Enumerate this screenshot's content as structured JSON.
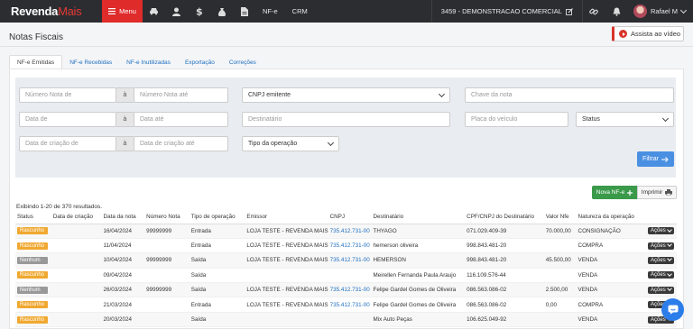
{
  "brand": {
    "name": "Revenda",
    "suffix": "Mais"
  },
  "topnav": {
    "menu_label": "Menu",
    "nfe_label": "NF-e",
    "crm_label": "CRM",
    "company": "3459 - DEMONSTRACAO COMERCIAL",
    "user": "Rafael M"
  },
  "header": {
    "title": "Notas Fiscais",
    "video_button": "Assista ao vídeo"
  },
  "tabs": [
    {
      "label": "NF-e Emitidas"
    },
    {
      "label": "NF-e Recebidas"
    },
    {
      "label": "NF-e Inutilizadas"
    },
    {
      "label": "Exportação"
    },
    {
      "label": "Correções"
    }
  ],
  "filters": {
    "numero_de": "Número Nota de",
    "numero_ate": "Número Nota até",
    "a": "à",
    "cnpj": "CNPJ emitente",
    "chave": "Chave da nota",
    "data_de": "Data de",
    "data_ate": "Data até",
    "destinatario": "Destinatário",
    "placa": "Placa do veículo",
    "status": "Status",
    "criacao_de": "Data de criação de",
    "criacao_ate": "Data de criação até",
    "tipo": "Tipo da operação",
    "filtrar": "Filtrar"
  },
  "actions": {
    "nova": "Nova NF-e",
    "imprimir": "Imprimir"
  },
  "results_text": "Exibindo 1-20 de 370 resultados.",
  "table": {
    "headers": [
      "Status",
      "Data de criação",
      "Data da nota",
      "Número Nota",
      "Tipo de operação",
      "Emissor",
      "CNPJ",
      "Destinatário",
      "CPF/CNPJ do Destinatário",
      "Valor Nfe",
      "Natureza da operação",
      ""
    ],
    "actions_label": "Ações",
    "rows": [
      {
        "status": "Rascunho",
        "criacao": "",
        "data": "16/04/2024",
        "numero": "99999999",
        "tipo": "Entrada",
        "emissor": "LOJA TESTE - REVENDA MAIS",
        "cnpj": "735.412.731-00",
        "dest": "THYAGO",
        "doc": "071.029.409-39",
        "valor": "70.000,00",
        "natureza": "CONSIGNAÇÃO"
      },
      {
        "status": "Rascunho",
        "criacao": "",
        "data": "11/04/2024",
        "numero": "",
        "tipo": "Entrada",
        "emissor": "LOJA TESTE - REVENDA MAIS",
        "cnpj": "735.412.731-00",
        "dest": "hemerson oliveira",
        "doc": "998.843.481-20",
        "valor": "",
        "natureza": "COMPRA"
      },
      {
        "status": "Nenhum",
        "criacao": "",
        "data": "10/04/2024",
        "numero": "99999999",
        "tipo": "Saída",
        "emissor": "LOJA TESTE - REVENDA MAIS",
        "cnpj": "735.412.731-00",
        "dest": "HEMERSON",
        "doc": "998.843.481-20",
        "valor": "45.500,00",
        "natureza": "VENDA"
      },
      {
        "status": "Rascunho",
        "criacao": "",
        "data": "09/04/2024",
        "numero": "",
        "tipo": "Saída",
        "emissor": "",
        "cnpj": "",
        "dest": "Meirellen Fernanda Paula Araujo",
        "doc": "116.109.576-44",
        "valor": "",
        "natureza": "VENDA"
      },
      {
        "status": "Nenhum",
        "criacao": "",
        "data": "26/03/2024",
        "numero": "99999999",
        "tipo": "Saída",
        "emissor": "LOJA TESTE - REVENDA MAIS",
        "cnpj": "735.412.731-00",
        "dest": "Felipe Gardel Gomes de Oliveira",
        "doc": "086.563.086-02",
        "valor": "2.500,00",
        "natureza": "VENDA"
      },
      {
        "status": "Rascunho",
        "criacao": "",
        "data": "21/03/2024",
        "numero": "",
        "tipo": "Entrada",
        "emissor": "LOJA TESTE - REVENDA MAIS",
        "cnpj": "735.412.731-00",
        "dest": "Felipe Gardel Gomes de Oliveira",
        "doc": "086.563.086-02",
        "valor": "0,00",
        "natureza": "COMPRA"
      },
      {
        "status": "Rascunho",
        "criacao": "",
        "data": "20/03/2024",
        "numero": "",
        "tipo": "Saída",
        "emissor": "",
        "cnpj": "",
        "dest": "Mix Auto Peças",
        "doc": "106.625.049-92",
        "valor": "",
        "natureza": "VENDA"
      }
    ]
  },
  "colors": {
    "brand_red": "#e02b2b",
    "topbar": "#2b2d31",
    "draft": "#f0a830",
    "none": "#999999",
    "link": "#1e6fbf",
    "success": "#3a9a4a"
  }
}
